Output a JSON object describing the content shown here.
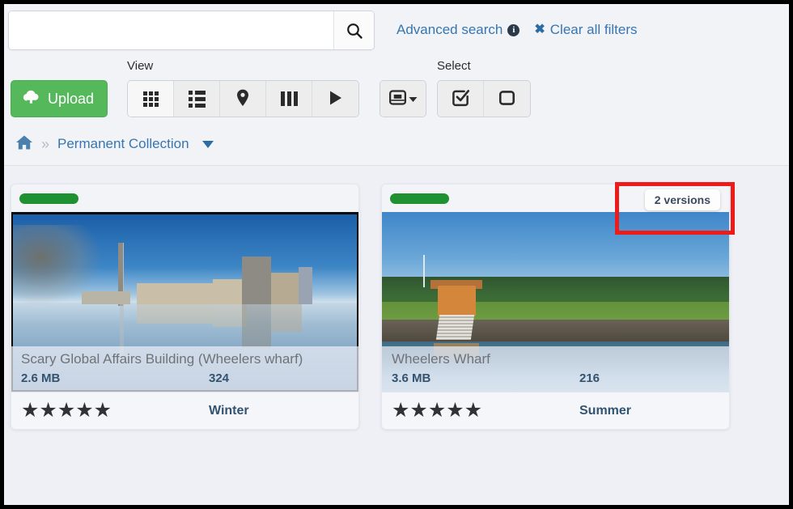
{
  "search": {
    "value": "",
    "placeholder": "",
    "search_button_icon": "search-icon"
  },
  "header_links": {
    "advanced_search": "Advanced search",
    "info_icon": "info-icon",
    "clear_filters": "Clear all filters",
    "clear_icon": "close-x-icon"
  },
  "toolbar": {
    "upload_label": "Upload",
    "upload_icon": "cloud-upload-icon",
    "view_label": "View",
    "select_label": "Select",
    "view_buttons": [
      {
        "name": "view-thumbnails",
        "icon": "grid-icon",
        "active": true
      },
      {
        "name": "view-list",
        "icon": "list-icon",
        "active": false
      },
      {
        "name": "view-map",
        "icon": "map-pin-icon",
        "active": false
      },
      {
        "name": "view-columns",
        "icon": "columns-icon",
        "active": false
      },
      {
        "name": "view-slideshow",
        "icon": "play-icon",
        "active": false
      }
    ],
    "dropdown_button": {
      "name": "display-options",
      "icon": "window-icon",
      "caret": "▾"
    },
    "select_buttons": [
      {
        "name": "select-all",
        "icon": "checked-box-icon"
      },
      {
        "name": "select-none",
        "icon": "empty-box-icon"
      }
    ]
  },
  "breadcrumb": {
    "home_icon": "home-icon",
    "separator": "»",
    "current": "Permanent Collection",
    "caret_icon": "chevron-down-icon"
  },
  "resources": [
    {
      "status_color": "#1f9130",
      "title": "Scary Global Affairs Building (Wheelers wharf)",
      "filesize": "2.6 MB",
      "id": "324",
      "stars": "★★★★★",
      "season": "Winter",
      "versions": null
    },
    {
      "status_color": "#1f9130",
      "title": "Wheelers Wharf",
      "filesize": "3.6 MB",
      "id": "216",
      "stars": "★★★★★",
      "season": "Summer",
      "versions": "2 versions"
    }
  ],
  "annotation": {
    "color": "#ee1b1b",
    "target": "versions-badge"
  }
}
